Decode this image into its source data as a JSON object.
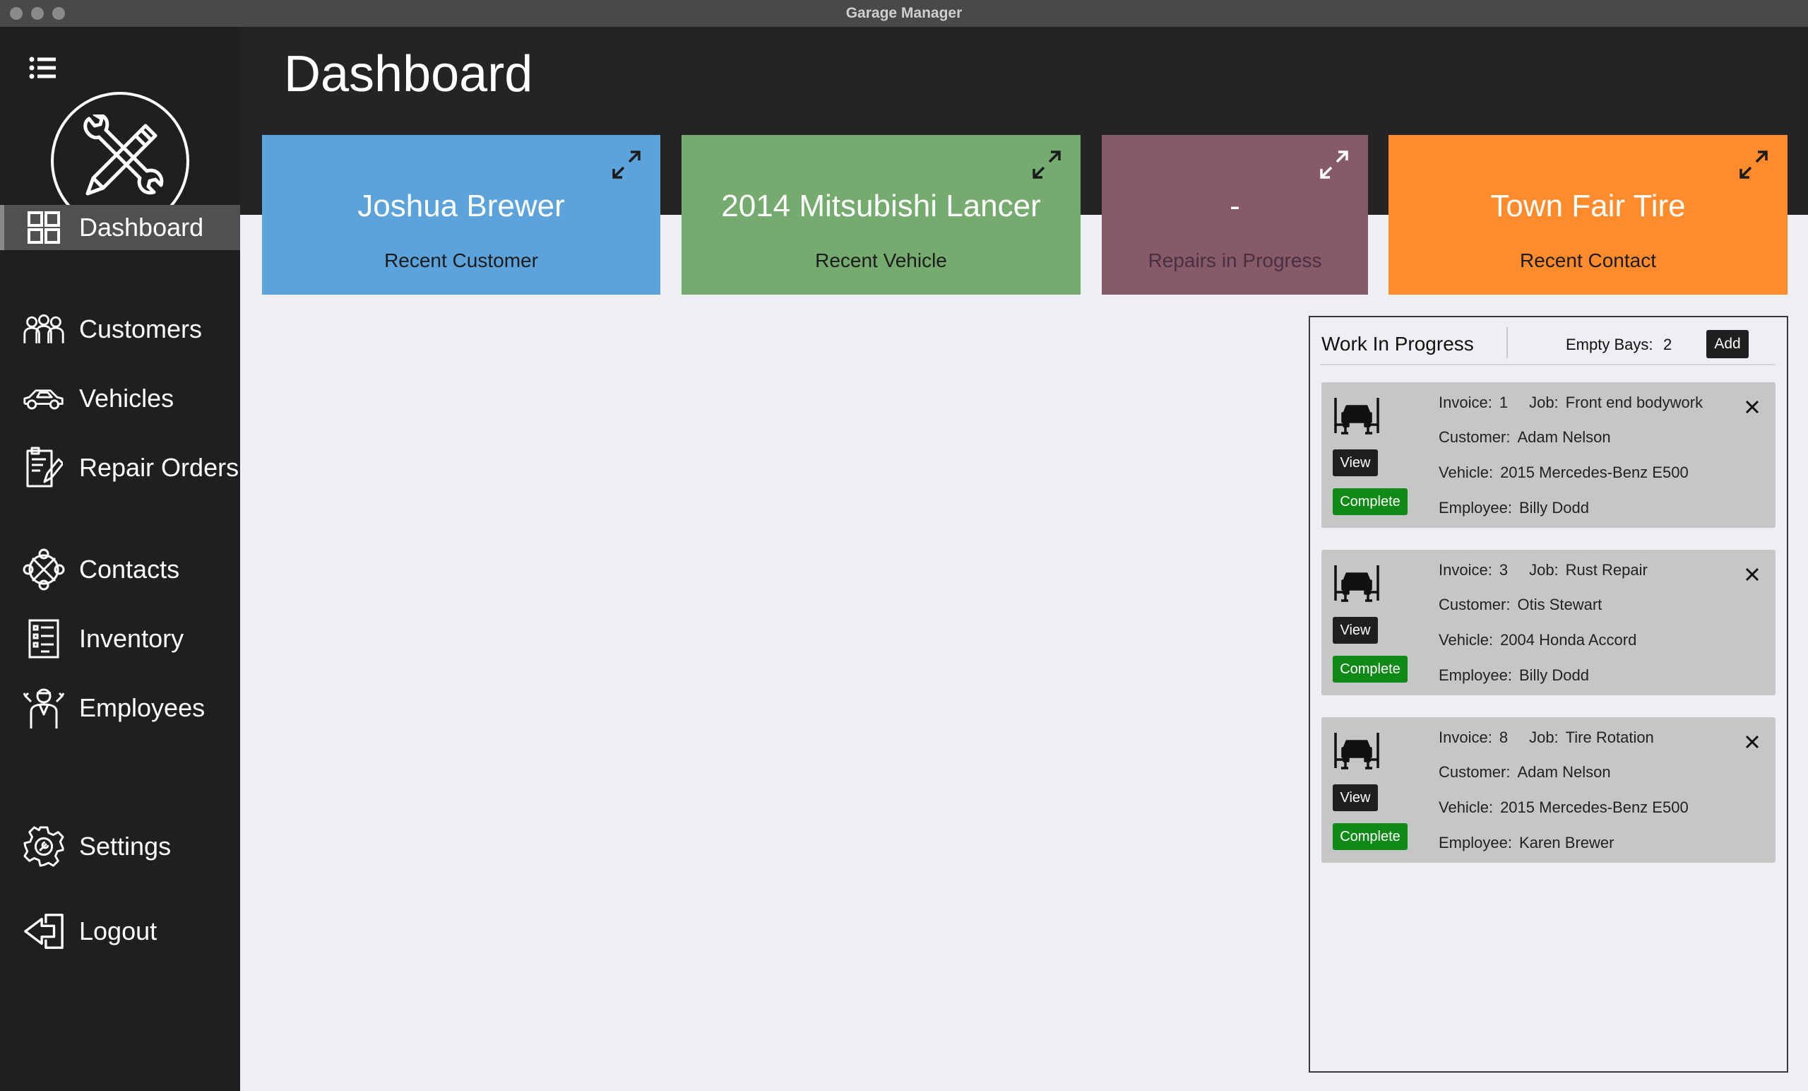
{
  "window": {
    "title": "Garage Manager"
  },
  "sidebar": {
    "items": [
      {
        "label": "Dashboard",
        "icon": "dashboard-grid-icon",
        "active": true
      },
      {
        "label": "Customers",
        "icon": "customers-icon"
      },
      {
        "label": "Vehicles",
        "icon": "car-icon"
      },
      {
        "label": "Repair Orders",
        "icon": "repair-order-icon"
      },
      {
        "label": "Contacts",
        "icon": "contacts-icon"
      },
      {
        "label": "Inventory",
        "icon": "inventory-list-icon"
      },
      {
        "label": "Employees",
        "icon": "employees-icon"
      },
      {
        "label": "Settings",
        "icon": "gear-icon"
      },
      {
        "label": "Logout",
        "icon": "logout-icon"
      }
    ]
  },
  "header": {
    "title": "Dashboard"
  },
  "cards": [
    {
      "value": "Joshua Brewer",
      "label": "Recent Customer",
      "color": "#5ca3dc"
    },
    {
      "value": "2014 Mitsubishi Lancer",
      "label": "Recent Vehicle",
      "color": "#76ab6f"
    },
    {
      "value": "-",
      "label": "Repairs in Progress",
      "color": "#865a6a"
    },
    {
      "value": "Town Fair Tire",
      "label": "Recent Contact",
      "color": "#ff8c2c"
    }
  ],
  "wip": {
    "title": "Work In Progress",
    "bays_label": "Empty Bays:",
    "bays_value": "2",
    "add_label": "Add",
    "view_label": "View",
    "complete_label": "Complete",
    "invoice_label": "Invoice:",
    "job_label": "Job:",
    "customer_label": "Customer:",
    "vehicle_label": "Vehicle:",
    "employee_label": "Employee:",
    "jobs": [
      {
        "invoice": "1",
        "job": "Front end bodywork",
        "customer": "Adam Nelson",
        "vehicle": "2015 Mercedes-Benz E500",
        "employee": "Billy Dodd"
      },
      {
        "invoice": "3",
        "job": "Rust Repair",
        "customer": "Otis Stewart",
        "vehicle": "2004 Honda Accord",
        "employee": "Billy Dodd"
      },
      {
        "invoice": "8",
        "job": "Tire Rotation",
        "customer": "Adam Nelson",
        "vehicle": "2015 Mercedes-Benz E500",
        "employee": "Karen Brewer"
      }
    ]
  }
}
